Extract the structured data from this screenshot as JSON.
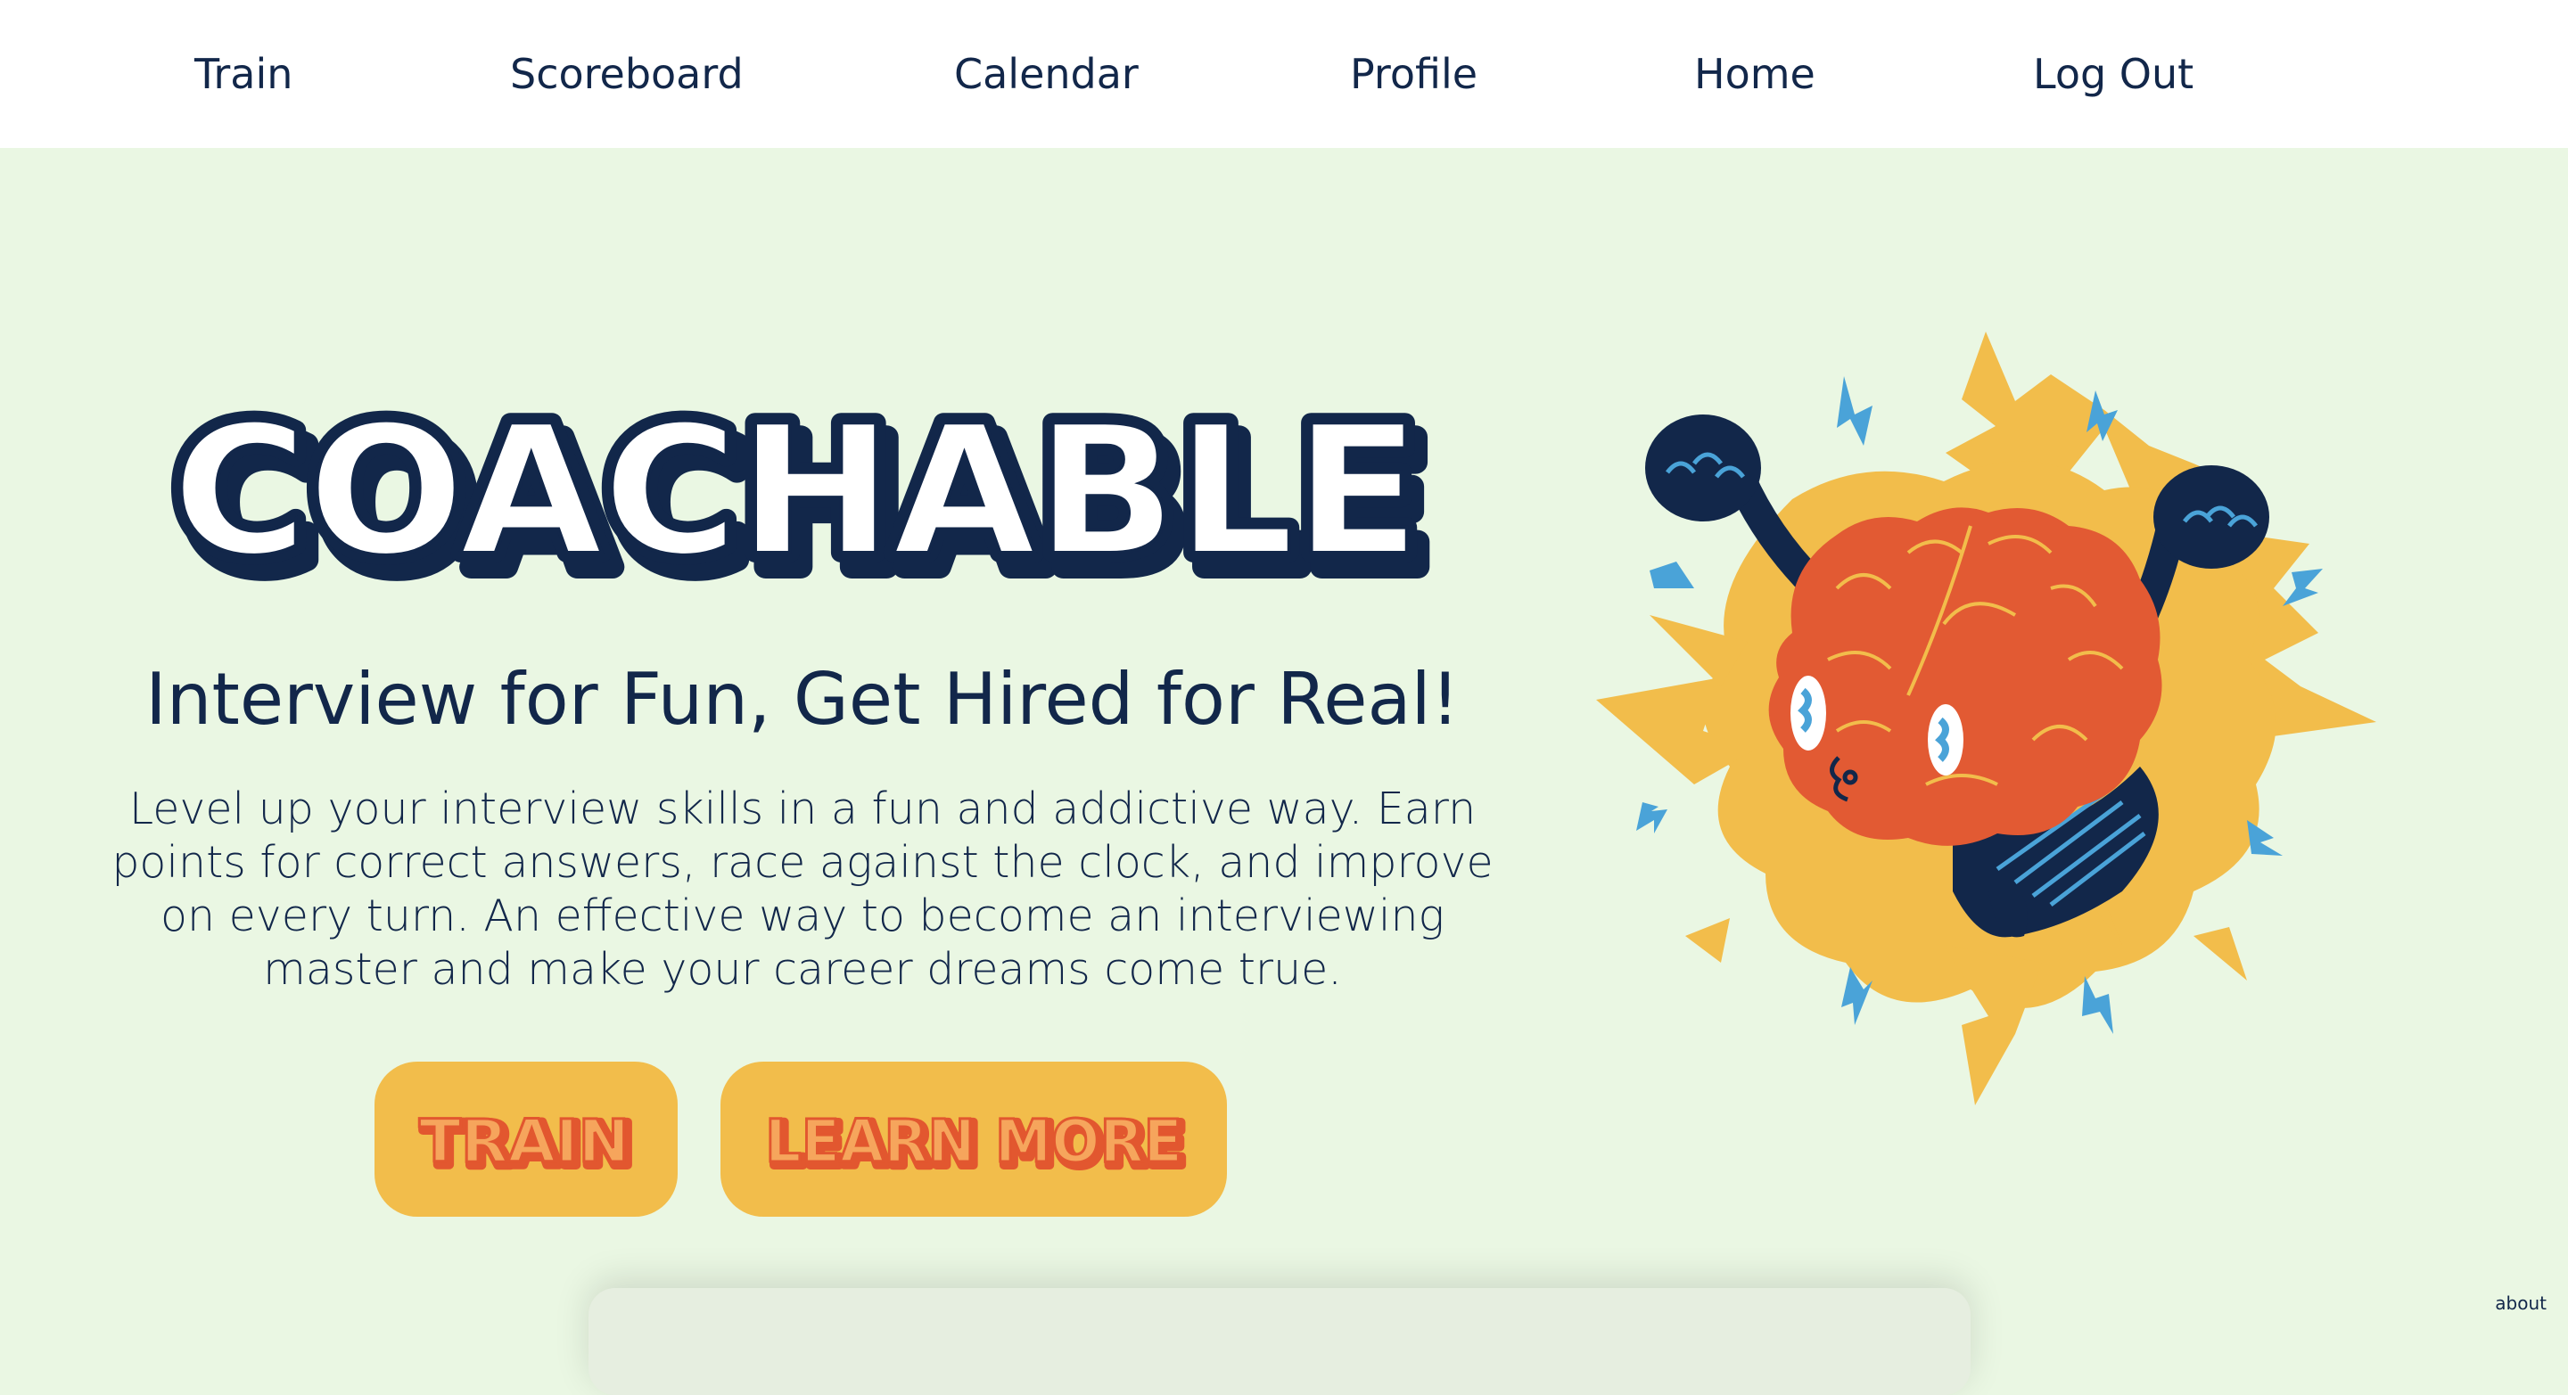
{
  "nav": {
    "items": [
      {
        "label": "Train"
      },
      {
        "label": "Scoreboard"
      },
      {
        "label": "Calendar"
      },
      {
        "label": "Profile"
      },
      {
        "label": "Home"
      },
      {
        "label": "Log Out"
      }
    ]
  },
  "hero": {
    "logo_text": "COACHABLE",
    "tagline": "Interview for Fun, Get Hired for Real!",
    "description": "Level up your interview skills in a fun and addictive way. Earn points for correct answers, race against the clock, and improve on every turn. An effective way to become an interviewing master and make your career dreams come true.",
    "train_button": "TRAIN",
    "learn_more_button": "LEARN MORE",
    "illustration_icon": "excited-brain-mascot-icon"
  },
  "footer": {
    "about_link": "about"
  },
  "colors": {
    "background": "#eaf7e3",
    "navbar": "#ffffff",
    "navy": "#12274a",
    "button_yellow": "#f2bd4b",
    "button_text_red": "#e2572f",
    "burst_yellow": "#f2bd4b",
    "brain_orange": "#e25a33",
    "spark_blue": "#4aa3d8"
  }
}
